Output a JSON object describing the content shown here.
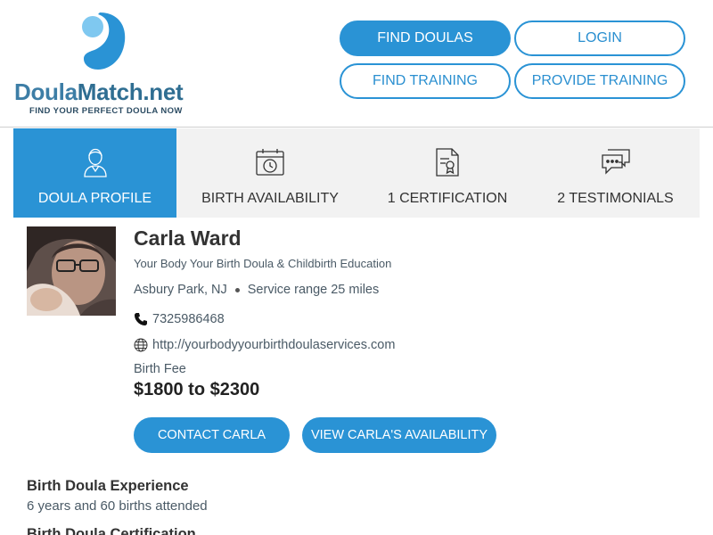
{
  "brand": {
    "name_part1": "Doula",
    "name_part2": "Match.net",
    "tagline": "FIND YOUR PERFECT DOULA NOW",
    "logo_icon": "droplet-logo-icon"
  },
  "colors": {
    "accent": "#2a93d5",
    "tab_bg": "#f2f2f2",
    "text": "#333333",
    "muted_text": "#4a5a66"
  },
  "nav": {
    "find_doulas": "FIND DOULAS",
    "login": "LOGIN",
    "find_training": "FIND TRAINING",
    "provide_training": "PROVIDE TRAINING"
  },
  "tabs": [
    {
      "label": "DOULA PROFILE",
      "icon": "person-icon",
      "active": true
    },
    {
      "label": "BIRTH AVAILABILITY",
      "icon": "calendar-clock-icon",
      "active": false
    },
    {
      "label": "1 CERTIFICATION",
      "icon": "certificate-icon",
      "active": false
    },
    {
      "label": "2 TESTIMONIALS",
      "icon": "chat-bubbles-icon",
      "active": false
    }
  ],
  "profile": {
    "name": "Carla Ward",
    "business": "Your Body Your Birth Doula & Childbirth Education",
    "city": "Asbury Park, NJ",
    "service_range": "Service range 25 miles",
    "phone": "7325986468",
    "website": "http://yourbodyyourbirthdoulaservices.com",
    "fee_label": "Birth Fee",
    "fee_value": "$1800 to $2300",
    "contact_button": "CONTACT CARLA",
    "availability_button": "VIEW CARLA'S AVAILABILITY"
  },
  "sections": {
    "experience_title": "Birth Doula Experience",
    "experience_text": "6 years and 60 births attended",
    "certification_title": "Birth Doula Certification"
  }
}
